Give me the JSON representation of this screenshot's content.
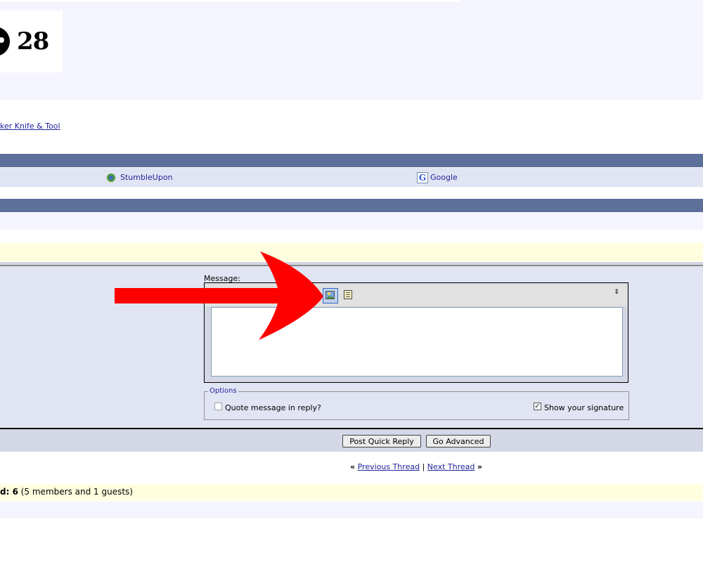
{
  "header": {
    "logo_number": "28"
  },
  "breadcrumb": {
    "link_text": "ker Knife & Tool"
  },
  "bookmarks": {
    "items": [
      {
        "label": "StumbleUpon",
        "icon": "stumbleupon-icon"
      },
      {
        "label": "Google",
        "icon": "google-icon",
        "glyph": "G"
      }
    ]
  },
  "quick_reply": {
    "message_label": "Message:",
    "resize_glyph": "⇕",
    "textarea_value": "",
    "options": {
      "legend": "Options",
      "quote_label": "Quote message in reply?",
      "signature_label": "Show your signature",
      "signature_check": "✓"
    },
    "buttons": {
      "post_label": "Post Quick Reply",
      "advanced_label": "Go Advanced"
    }
  },
  "thread_nav": {
    "left_quote": "«",
    "previous": "Previous Thread",
    "separator": "|",
    "next": "Next Thread",
    "right_quote": "»"
  },
  "viewers": {
    "prefix": "d: 6",
    "detail": " (5 members and 1 guests)"
  },
  "colors": {
    "tcat": "#5c7099",
    "alt_row": "#e1e4f2",
    "highlight_row": "#ffffe0",
    "link": "#22229c",
    "annotation_arrow": "#ff0000"
  }
}
